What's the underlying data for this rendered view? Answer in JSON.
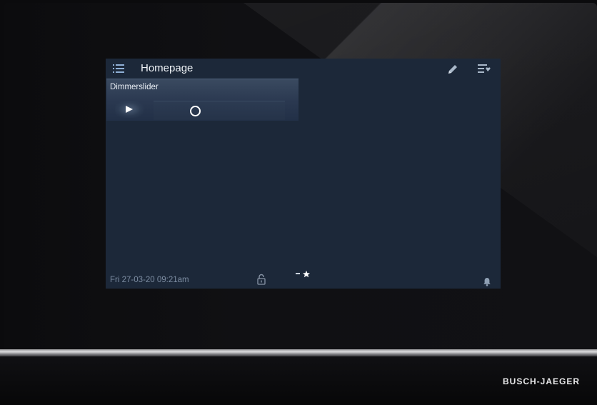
{
  "brand": {
    "name": "BUSCH-JAEGER"
  },
  "screen": {
    "title": "Homepage",
    "header_icons": {
      "menu": "menu-list-icon",
      "edit": "pencil-icon",
      "favorites": "favorites-list-icon"
    }
  },
  "tile": {
    "title": "Dimmerslider",
    "play_icon": "play-icon",
    "slider_level": 0.3
  },
  "status": {
    "datetime": "Fri 27-03-20  09:21am",
    "lock_icon": "padlock-icon",
    "pages": [
      "page-dash",
      "favorites-star"
    ],
    "bell_icon": "bell-icon"
  },
  "colors": {
    "screen_bg": "#1c2839",
    "tile_bg": "#2a3850",
    "text": "#eef2f6",
    "muted_text": "#7d8da2",
    "accent_white": "#ffffff"
  }
}
